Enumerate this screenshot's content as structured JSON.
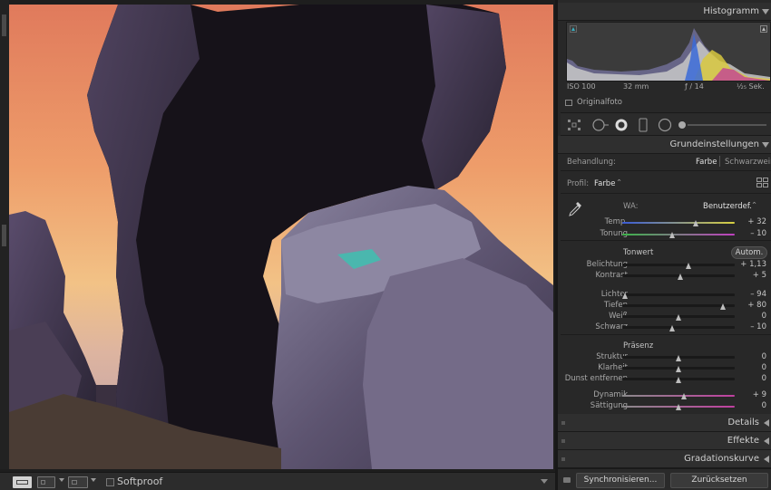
{
  "toolbar": {
    "softproof_label": "Softproof"
  },
  "panel": {
    "sections": {
      "histogram": "Histogramm",
      "basic": "Grundeinstellungen",
      "details": "Details",
      "effects": "Effekte",
      "tone_curve": "Gradationskurve"
    },
    "exif": {
      "iso": "ISO 100",
      "focal": "32 mm",
      "aperture": "ƒ / 14",
      "shutter": "¹⁄₂₅ Sek."
    },
    "original_photo_label": "Originalfoto",
    "treatment": {
      "label": "Behandlung:",
      "color": "Farbe",
      "bw": "Schwarzweiß"
    },
    "profile": {
      "label": "Profil:",
      "value": "Farbe"
    },
    "wb": {
      "label": "WA:",
      "value": "Benutzerdef."
    },
    "groups": {
      "tone": "Tonwert",
      "auto": "Autom.",
      "presence": "Präsenz"
    },
    "sliders": [
      {
        "id": "temp",
        "label": "Temp.",
        "value": "+ 32",
        "pos": 0.66,
        "gradient": [
          "#3a5bd6",
          "#d8d040"
        ]
      },
      {
        "id": "tint",
        "label": "Tonung",
        "value": "– 10",
        "pos": 0.45,
        "gradient": [
          "#3cb34a",
          "#c040c0"
        ]
      },
      {
        "id": "exposure",
        "label": "Belichtung",
        "value": "+ 1,13",
        "pos": 0.59
      },
      {
        "id": "contrast",
        "label": "Kontrast",
        "value": "+ 5",
        "pos": 0.52
      },
      {
        "id": "highlights",
        "label": "Lichter",
        "value": "– 94",
        "pos": 0.03
      },
      {
        "id": "shadows",
        "label": "Tiefen",
        "value": "+ 80",
        "pos": 0.9
      },
      {
        "id": "whites",
        "label": "Weiß",
        "value": "0",
        "pos": 0.5
      },
      {
        "id": "blacks",
        "label": "Schwarz",
        "value": "– 10",
        "pos": 0.45
      },
      {
        "id": "texture",
        "label": "Struktur",
        "value": "0",
        "pos": 0.5
      },
      {
        "id": "clarity",
        "label": "Klarheit",
        "value": "0",
        "pos": 0.5
      },
      {
        "id": "dehaze",
        "label": "Dunst entfernen",
        "value": "0",
        "pos": 0.5
      },
      {
        "id": "vibrance",
        "label": "Dynamik",
        "value": "+ 9",
        "pos": 0.55,
        "gradient": [
          "#8a8a8a",
          "#c040a0"
        ]
      },
      {
        "id": "saturation",
        "label": "Sättigung",
        "value": "0",
        "pos": 0.5,
        "gradient": [
          "#8a8a8a",
          "#c040a0"
        ]
      }
    ],
    "buttons": {
      "sync": "Synchronisieren...",
      "reset": "Zurücksetzen"
    }
  },
  "colors": {
    "panel_bg": "#282828",
    "header_bg": "#2f2f2f",
    "text": "#b4b4b4"
  },
  "icons": [
    "eyedropper-icon",
    "grid-view-icon",
    "crop-overlay-icon",
    "spot-removal-icon",
    "red-eye-icon",
    "graduated-filter-icon",
    "radial-filter-icon",
    "adjustment-brush-icon",
    "profile-browser-icon"
  ]
}
